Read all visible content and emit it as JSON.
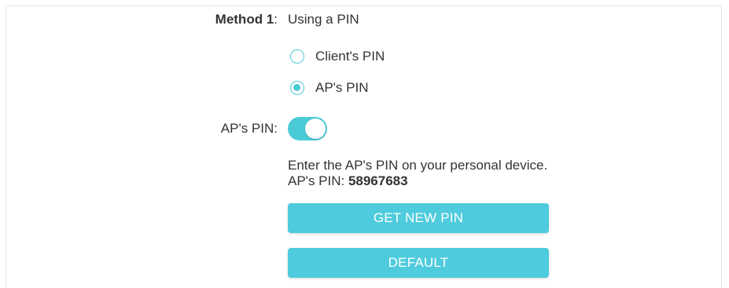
{
  "method": {
    "label": "Method 1",
    "colon": ":",
    "value": "Using a PIN"
  },
  "radios": [
    {
      "label": "Client's PIN",
      "checked": false
    },
    {
      "label": "AP's PIN",
      "checked": true
    }
  ],
  "ap_pin_toggle": {
    "label": "AP's PIN",
    "colon": ":",
    "on": true
  },
  "info": {
    "instruction": "Enter the AP's PIN on your personal device.",
    "pin_prefix": "AP's PIN: ",
    "pin_value": "58967683"
  },
  "buttons": {
    "get_new_pin": "GET NEW PIN",
    "default": "DEFAULT"
  },
  "colors": {
    "accent": "#4acbd6",
    "button": "#4ecbdc",
    "text": "#333333"
  }
}
